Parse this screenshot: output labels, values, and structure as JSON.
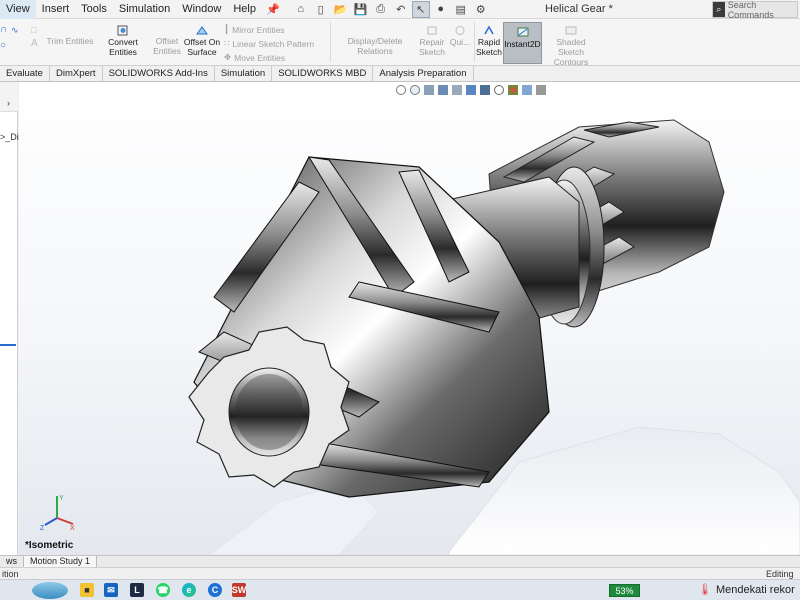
{
  "menubar": {
    "items": [
      "View",
      "Insert",
      "Tools",
      "Simulation",
      "Window",
      "Help"
    ],
    "doc_title": "Helical Gear *",
    "search_placeholder": "Search Commands"
  },
  "ribbon": {
    "trim_entities": "Trim Entities",
    "convert_entities": "Convert Entities",
    "offset_entities_line1": "Offset",
    "offset_entities_line2": "Entities",
    "offset_on_surface_line1": "Offset On",
    "offset_on_surface_line2": "Surface",
    "mirror_entities": "Mirror Entities",
    "linear_sketch_pattern": "Linear Sketch Pattern",
    "move_entities": "Move Entities",
    "display_delete_relations": "Display/Delete Relations",
    "repair_sketch_line1": "Repair",
    "repair_sketch_line2": "Sketch",
    "quick_snaps": "Qui...",
    "rapid_sketch_line1": "Rapid",
    "rapid_sketch_line2": "Sketch",
    "instant2d": "Instant2D",
    "shaded_sketch_line1": "Shaded Sketch",
    "shaded_sketch_line2": "Contours"
  },
  "command_tabs": [
    "Evaluate",
    "DimXpert",
    "SOLIDWORKS Add-Ins",
    "Simulation",
    "SOLIDWORKS MBD",
    "Analysis Preparation"
  ],
  "feature_tree": {
    "partial_text": ">_Di"
  },
  "viewport": {
    "view_label": "*Isometric"
  },
  "bottom_tabs": [
    "ws",
    "Motion Study 1"
  ],
  "status": {
    "left": "ition",
    "right": "Editing P"
  },
  "taskbar": {
    "battery": "53%",
    "weather_text": "Mendekati rekor"
  },
  "colors": {
    "accent_blue": "#2a6ccf",
    "battery_green": "#1e8a3d"
  }
}
